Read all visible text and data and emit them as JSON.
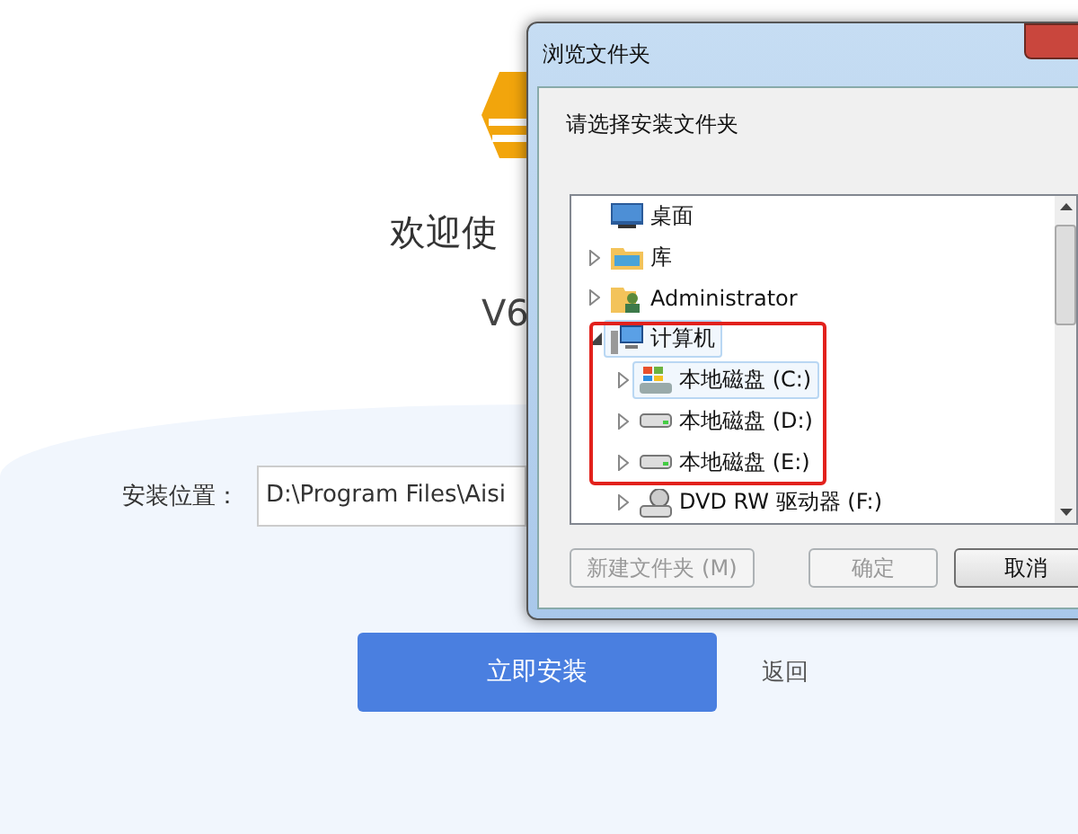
{
  "installer": {
    "welcome": "欢迎使",
    "version": "V6",
    "path_label": "安装位置：",
    "path_value": "D:\\Program Files\\Aisi",
    "install_button": "立即安装",
    "back_link": "返回"
  },
  "dialog": {
    "title": "浏览文件夹",
    "prompt": "请选择安装文件夹",
    "tree": [
      {
        "label": "桌面",
        "kind": "desktop",
        "selected": false,
        "children": [
          {
            "label": "库",
            "kind": "library",
            "expanded": false,
            "selected": false
          },
          {
            "label": "Administrator",
            "kind": "user",
            "expanded": false,
            "selected": false
          },
          {
            "label": "计算机",
            "kind": "computer",
            "expanded": true,
            "selected": true,
            "children": [
              {
                "label": "本地磁盘 (C:)",
                "kind": "systemdrive",
                "expanded": false,
                "selected": true
              },
              {
                "label": "本地磁盘 (D:)",
                "kind": "drive",
                "expanded": false,
                "selected": false
              },
              {
                "label": "本地磁盘 (E:)",
                "kind": "drive",
                "expanded": false,
                "selected": false
              },
              {
                "label": "DVD RW 驱动器 (F:)",
                "kind": "dvd",
                "expanded": false,
                "selected": false
              }
            ]
          }
        ]
      }
    ],
    "buttons": [
      {
        "label": "新建文件夹 (M)",
        "disabled": true
      },
      {
        "label": "确定",
        "disabled": true
      },
      {
        "label": "取消",
        "disabled": false
      }
    ]
  }
}
